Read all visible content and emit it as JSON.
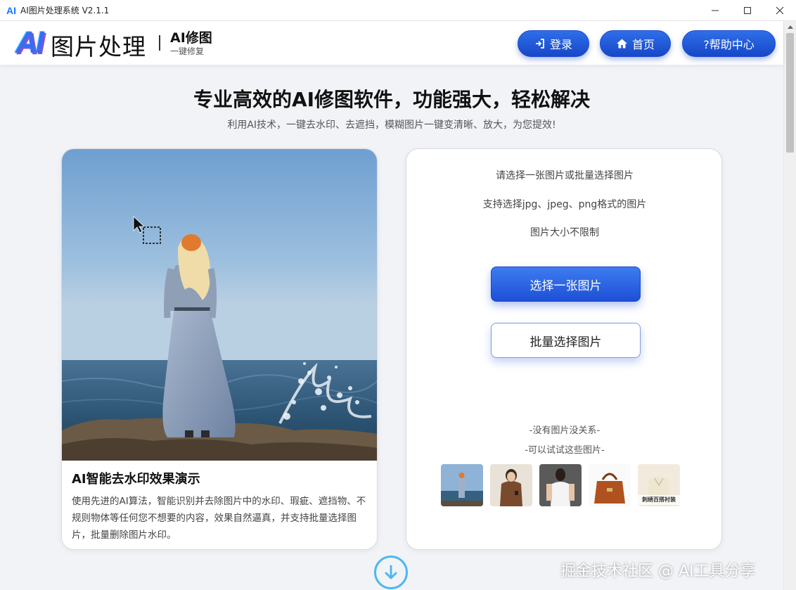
{
  "titlebar": {
    "logo": "AI",
    "title": "AI图片处理系统 V2.1.1",
    "minimize_icon": "minimize-icon",
    "maximize_icon": "maximize-icon",
    "close_icon": "close-icon"
  },
  "header": {
    "logo": "AI",
    "app_name": "图片处理",
    "sub_title": "AI修图",
    "sub_caption": "一键修复",
    "nav": [
      {
        "label": "登录",
        "icon": "login-icon"
      },
      {
        "label": "首页",
        "icon": "home-icon"
      },
      {
        "label": "?帮助中心",
        "icon": "help-icon"
      }
    ]
  },
  "main": {
    "headline": "专业高效的AI修图软件，功能强大，轻松解决",
    "subline": "利用AI技术，一键去水印、去遮挡，模糊图片一键变清晰、放大，为您提效!",
    "demo": {
      "title": "AI智能去水印效果演示",
      "description": "使用先进的AI算法，智能识别并去除图片中的水印、瑕疵、遮挡物、不规则物体等任何您不想要的内容，效果自然逼真，并支持批量选择图片，批量删除图片水印。"
    },
    "upload": {
      "tip1": "请选择一张图片或批量选择图片",
      "tip2": "支持选择jpg、jpeg、png格式的图片",
      "tip3": "图片大小不限制",
      "single_button": "选择一张图片",
      "batch_button": "批量选择图片",
      "no_image": "-没有图片没关系-",
      "try_images": "-可以试试这些图片-",
      "samples": [
        {
          "name": "sample-seaside-woman",
          "caption": ""
        },
        {
          "name": "sample-brown-sweater",
          "caption": ""
        },
        {
          "name": "sample-white-top",
          "caption": ""
        },
        {
          "name": "sample-handbag",
          "caption": ""
        },
        {
          "name": "sample-shirt",
          "caption": "刺绣百搭衬装"
        }
      ]
    },
    "scroll_down_icon": "arrow-down-circle-icon"
  },
  "watermark": "掘金技术社区 @ AI工具分享",
  "colors": {
    "primary": "#1e4fd6",
    "accent": "#4db8f0",
    "background": "#f1f3f6"
  }
}
